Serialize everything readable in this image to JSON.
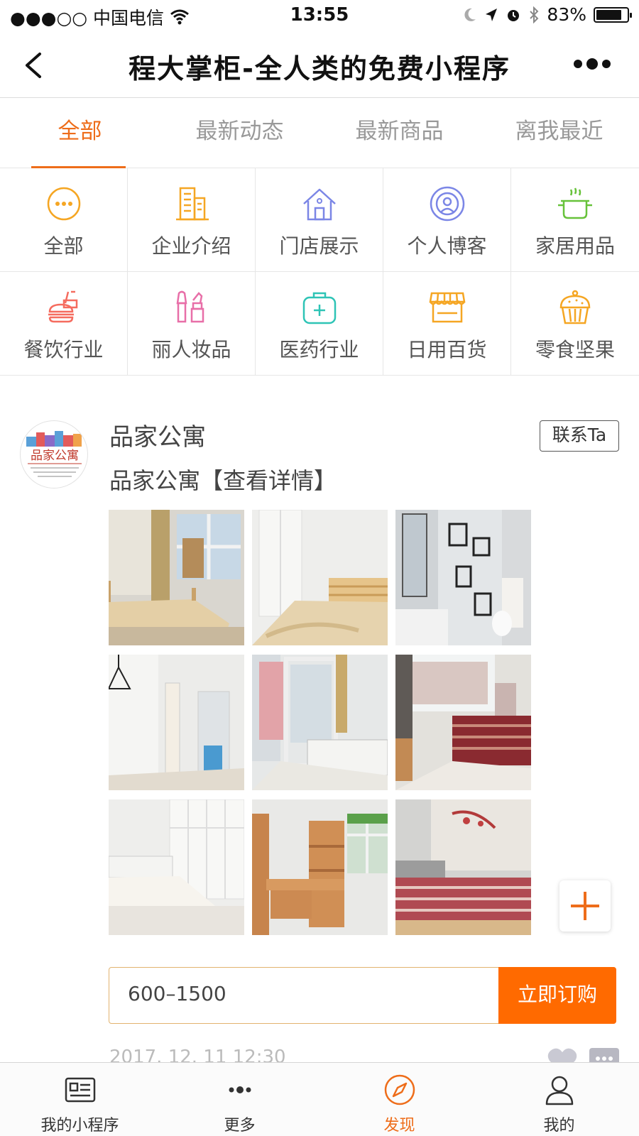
{
  "status_bar": {
    "carrier": "●●●○○ 中国电信",
    "time": "13:55",
    "battery": "83%",
    "battery_level": 0.83
  },
  "nav": {
    "title": "程大掌柜-全人类的免费小程序"
  },
  "tabs": [
    {
      "label": "全部",
      "active": true
    },
    {
      "label": "最新动态",
      "active": false
    },
    {
      "label": "最新商品",
      "active": false
    },
    {
      "label": "离我最近",
      "active": false
    }
  ],
  "categories": [
    {
      "label": "全部",
      "icon": "ellipsis-circle-icon",
      "color": "#f5a623"
    },
    {
      "label": "企业介绍",
      "icon": "building-icon",
      "color": "#f5a623"
    },
    {
      "label": "门店展示",
      "icon": "house-icon",
      "color": "#7b86e6"
    },
    {
      "label": "个人博客",
      "icon": "person-circle-icon",
      "color": "#7b86e6"
    },
    {
      "label": "家居用品",
      "icon": "pot-icon",
      "color": "#67c23a"
    },
    {
      "label": "餐饮行业",
      "icon": "fastfood-icon",
      "color": "#f56c5f"
    },
    {
      "label": "丽人妆品",
      "icon": "makeup-icon",
      "color": "#e86fa8"
    },
    {
      "label": "医药行业",
      "icon": "medkit-icon",
      "color": "#2ec4b6"
    },
    {
      "label": "日用百货",
      "icon": "store-icon",
      "color": "#f5a623"
    },
    {
      "label": "零食坚果",
      "icon": "cupcake-icon",
      "color": "#f5a623"
    }
  ],
  "post": {
    "avatar_text": "品家公寓",
    "name": "品家公寓",
    "contact_label": "联系Ta",
    "description": "品家公寓【查看详情】",
    "photos": [
      "bedroom-photo",
      "bedroom-photo",
      "bathroom-photo",
      "hallway-photo",
      "bedroom-photo",
      "bedroom-photo",
      "bedroom-photo",
      "study-photo",
      "bedroom-photo"
    ],
    "price": "600–1500",
    "buy_label": "立即订购",
    "timestamp": "2017. 12. 11 12:30"
  },
  "tabbar": [
    {
      "label": "我的小程序",
      "icon": "id-card-icon",
      "active": false
    },
    {
      "label": "更多",
      "icon": "dots-icon",
      "active": false
    },
    {
      "label": "发现",
      "icon": "compass-icon",
      "active": true
    },
    {
      "label": "我的",
      "icon": "user-icon",
      "active": false
    }
  ],
  "colors": {
    "accent": "#ee6d1a",
    "buy_button": "#ff6a00"
  }
}
